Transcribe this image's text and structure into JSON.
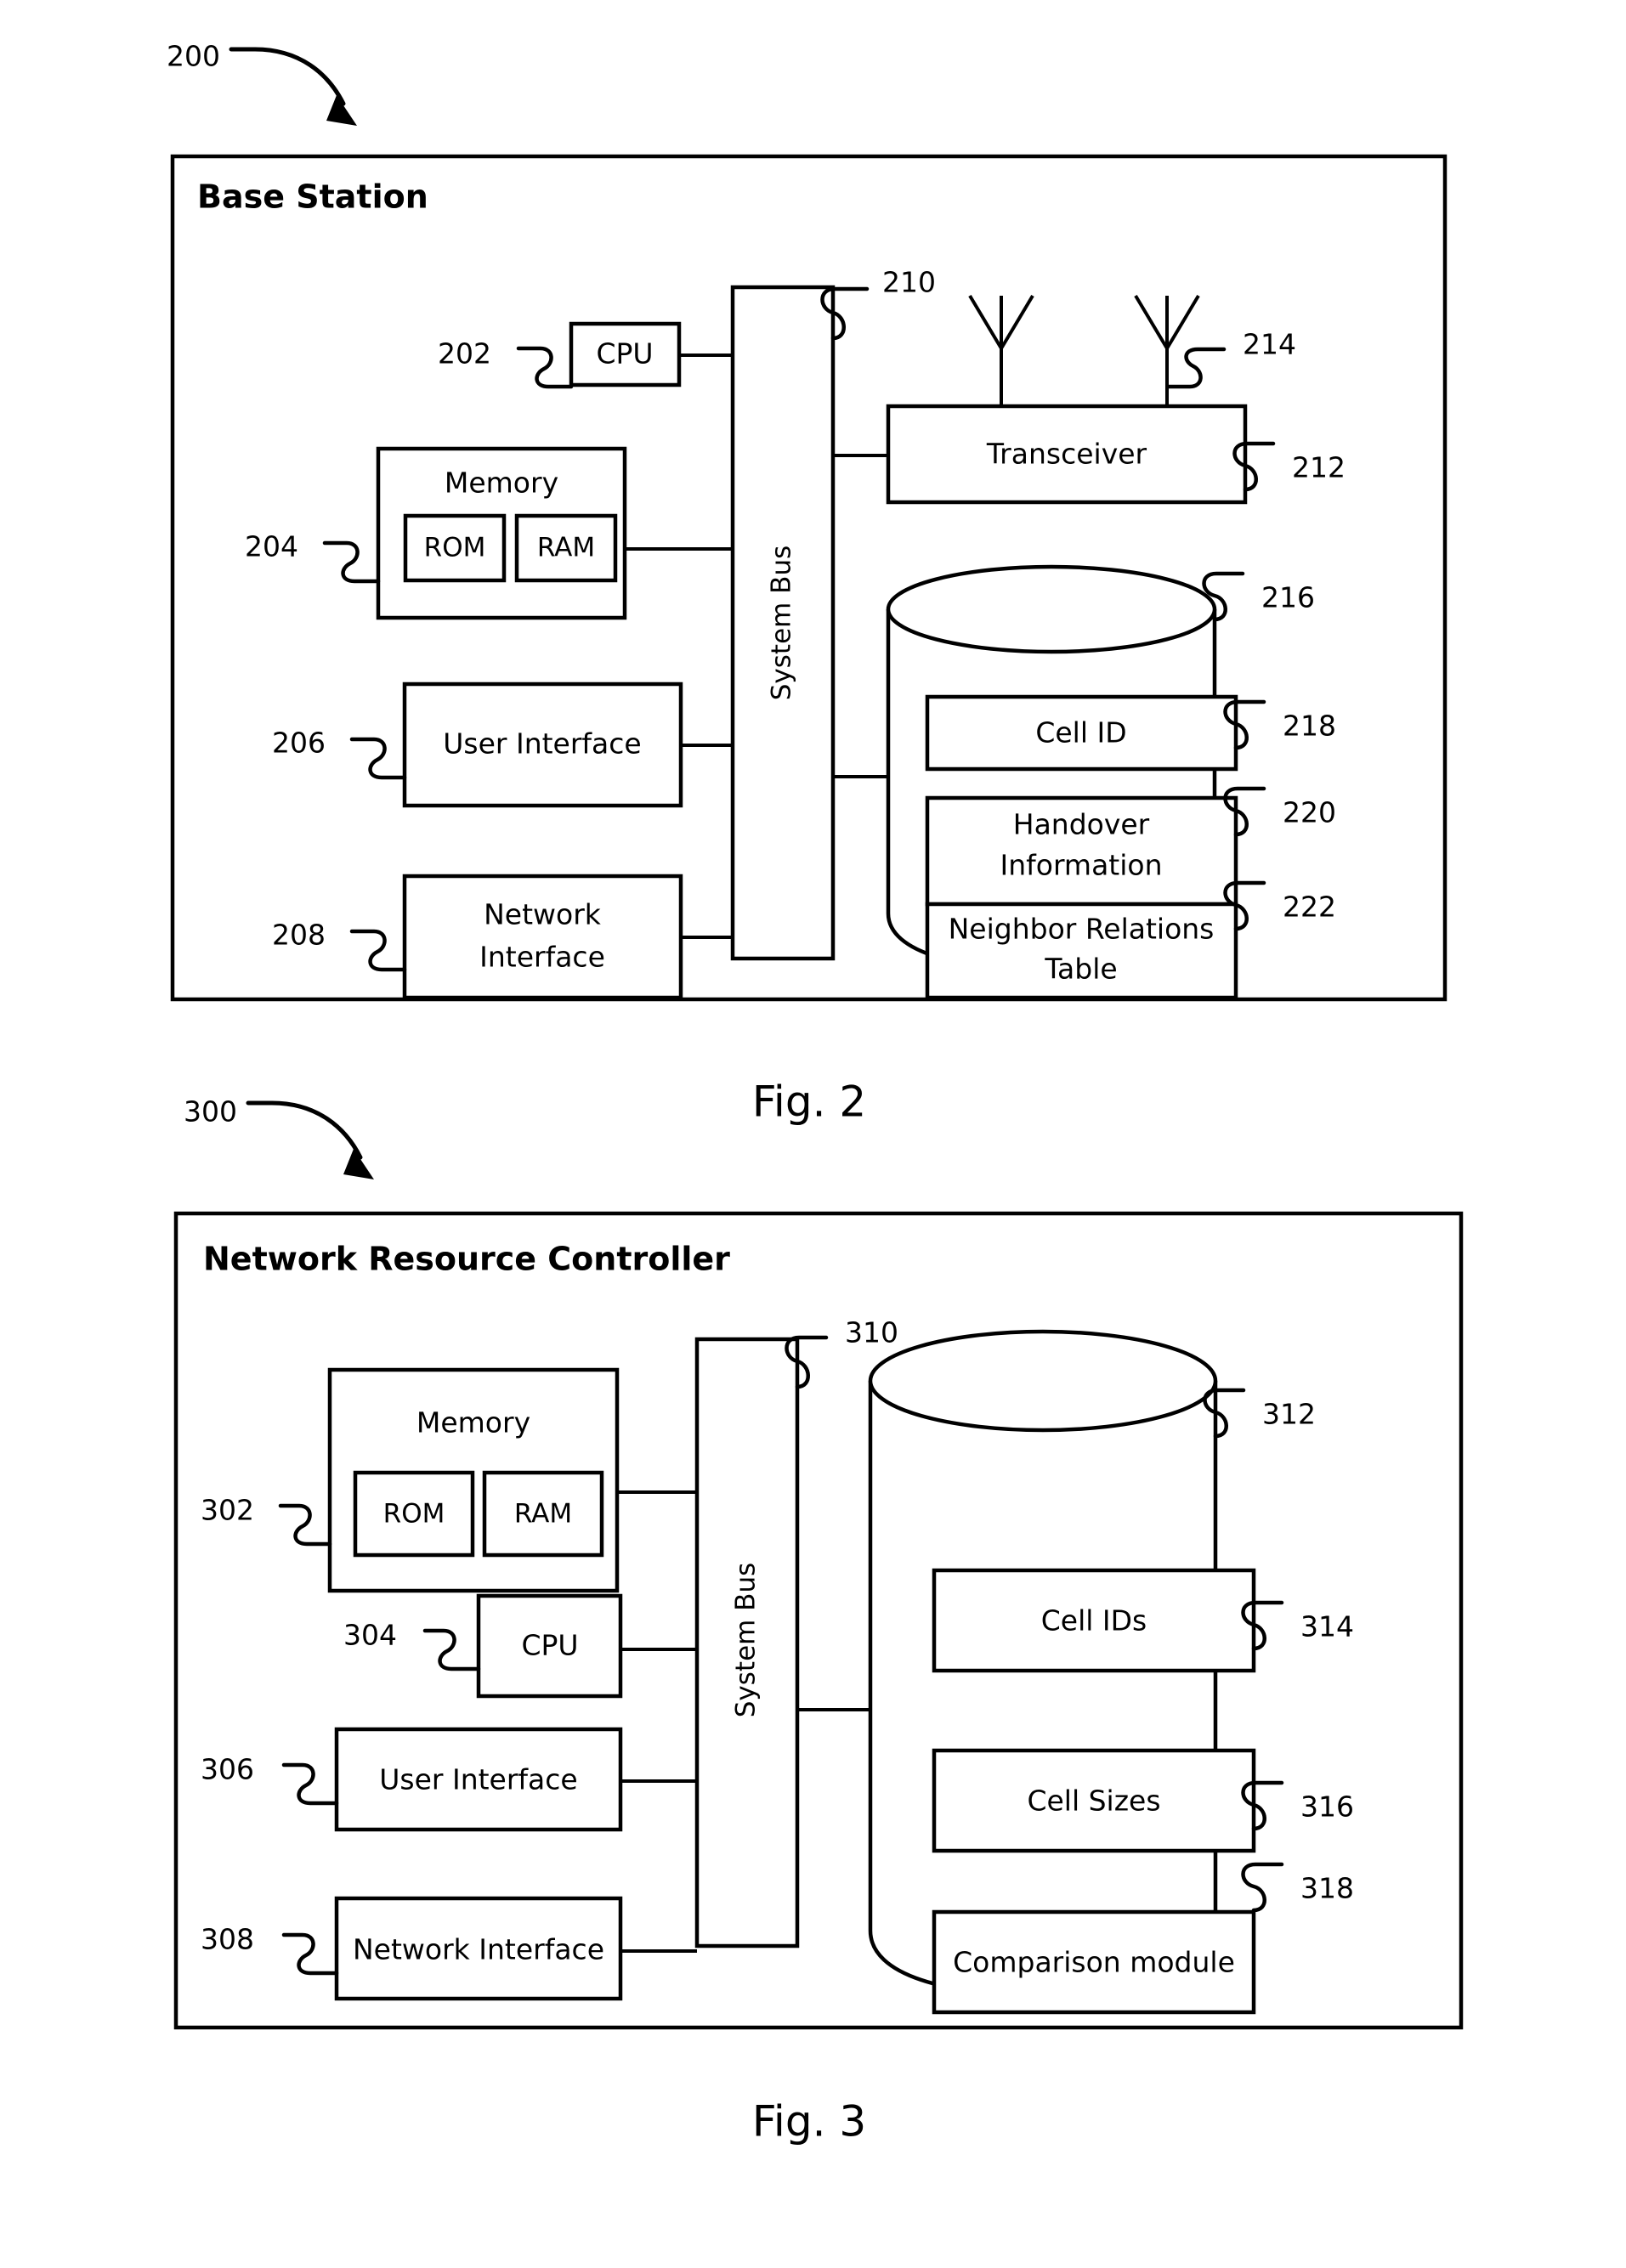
{
  "document": {
    "kind": "patent-drawing-sheet",
    "figures": [
      "Fig. 2",
      "Fig. 3"
    ]
  },
  "fig2": {
    "figure_caption": "Fig. 2",
    "figure_ref": "200",
    "panel_title": "Base Station",
    "bus_label": "System Bus",
    "bus_ref": "210",
    "blocks": [
      {
        "label": "CPU",
        "ref": "202"
      },
      {
        "label": "Memory",
        "ref": "204"
      },
      {
        "label": "ROM",
        "ref": ""
      },
      {
        "label": "RAM",
        "ref": ""
      },
      {
        "label": "User Interface",
        "ref": "206"
      },
      {
        "label": "Network Interface",
        "ref": "208"
      },
      {
        "label": "Transceiver",
        "ref": "212"
      }
    ],
    "memory_label": "Memory",
    "memory_ref": "204",
    "rom_label": "ROM",
    "ram_label": "RAM",
    "cpu_label": "CPU",
    "cpu_ref": "202",
    "user_interface_label": "User Interface",
    "user_interface_ref": "206",
    "network_interface_line1": "Network",
    "network_interface_line2": "Interface",
    "network_interface_ref": "208",
    "transceiver_label": "Transceiver",
    "transceiver_ref": "212",
    "antenna_ref": "214",
    "database_ref": "216",
    "db_items": [
      {
        "line1": "Cell ID",
        "line2": "",
        "ref": "218"
      },
      {
        "line1": "Handover",
        "line2": "Information",
        "ref": "220"
      },
      {
        "line1": "Neighbor Relations",
        "line2": "Table",
        "ref": "222"
      }
    ]
  },
  "fig3": {
    "figure_caption": "Fig. 3",
    "figure_ref": "300",
    "panel_title": "Network Resource Controller",
    "bus_label": "System Bus",
    "bus_ref": "310",
    "memory_label": "Memory",
    "memory_ref": "302",
    "rom_label": "ROM",
    "ram_label": "RAM",
    "cpu_label": "CPU",
    "cpu_ref": "304",
    "user_interface_label": "User Interface",
    "user_interface_ref": "306",
    "network_interface_label": "Network Interface",
    "network_interface_ref": "308",
    "database_ref": "312",
    "db_items": [
      {
        "label": "Cell IDs",
        "ref": "314"
      },
      {
        "label": "Cell Sizes",
        "ref": "316"
      },
      {
        "label": "Comparison module",
        "ref": "318"
      }
    ]
  },
  "colors": {
    "ink": "#000000",
    "paper": "#ffffff"
  }
}
